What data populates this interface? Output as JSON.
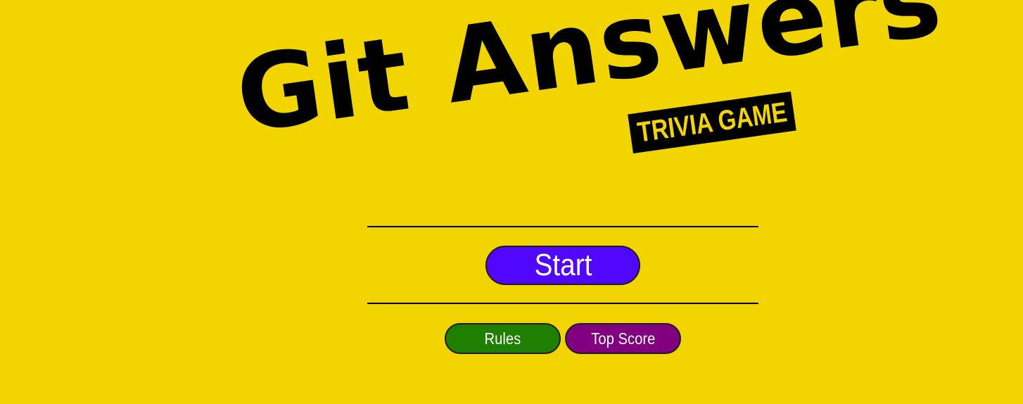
{
  "logo": {
    "title": "Git Answers",
    "tagline": "TRIVIA GAME"
  },
  "menu": {
    "start_label": "Start",
    "rules_label": "Rules",
    "top_score_label": "Top Score"
  },
  "colors": {
    "background": "#f2d500",
    "logo_text": "#000000",
    "start_button": "#5107fb",
    "rules_button": "#1e7f00",
    "top_score_button": "#800080",
    "button_text": "#ffffff"
  }
}
